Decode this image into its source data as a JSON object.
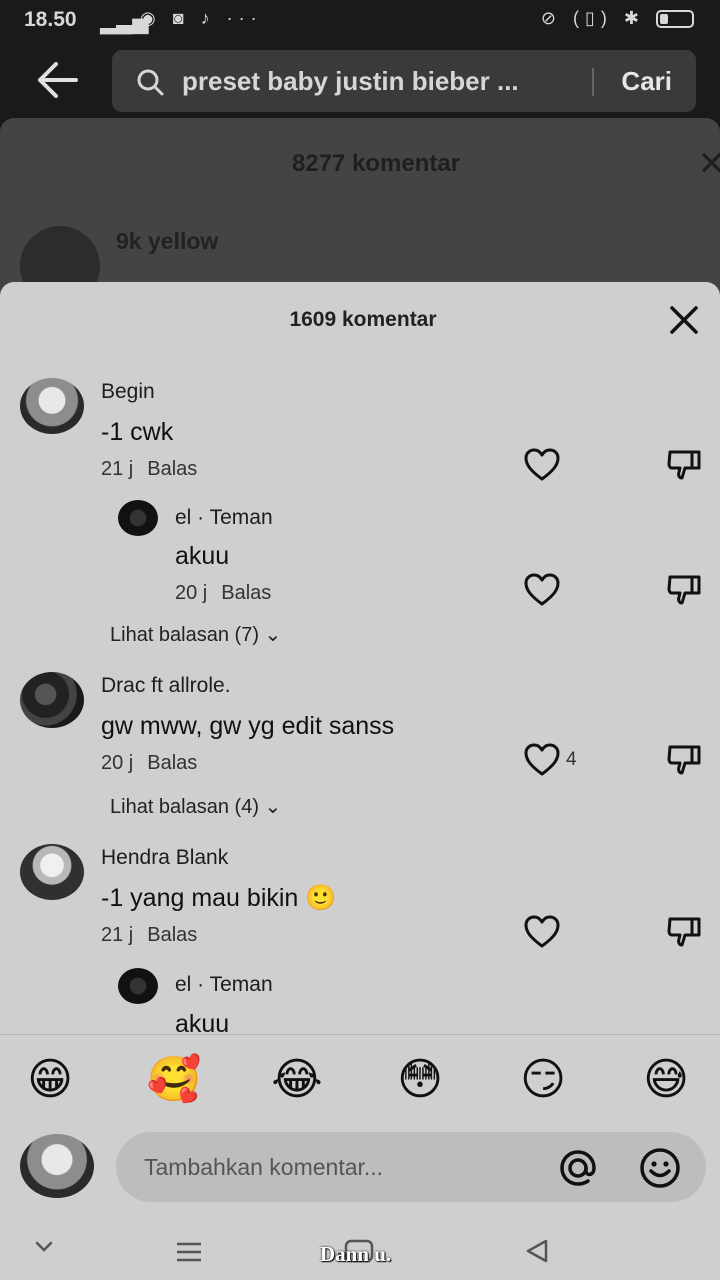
{
  "status_bar": {
    "time": "18.50",
    "signal": "▂▃▅",
    "apps": "◉ ◙ ♪ ···",
    "right": "⊘ (▯) ✱"
  },
  "search": {
    "query": "preset baby justin bieber ...",
    "action": "Cari"
  },
  "background_panel": {
    "title": "8277 komentar",
    "first_user": "9k yellow"
  },
  "sheet": {
    "title": "1609 komentar"
  },
  "comments": [
    {
      "user": "Begin",
      "text": "-1 cwk",
      "time": "21 j",
      "reply_label": "Balas",
      "likes": ""
    },
    {
      "user": "el · Teman",
      "text": "akuu",
      "time": "20 j",
      "reply_label": "Balas",
      "likes": ""
    },
    {
      "user": "Drac ft allrole.",
      "text": "gw mww, gw yg edit sanss",
      "time": "20 j",
      "reply_label": "Balas",
      "likes": "4"
    },
    {
      "user": "Hendra Blank",
      "text": "-1 yang mau bikin 🙂",
      "time": "21 j",
      "reply_label": "Balas",
      "likes": ""
    },
    {
      "user": "el · Teman",
      "text": "akuu",
      "time": "",
      "reply_label": "",
      "likes": ""
    }
  ],
  "view_replies": [
    "Lihat balasan (7)",
    "Lihat balasan (4)"
  ],
  "emojis": [
    "😁",
    "🥰",
    "😂",
    "😳",
    "😏",
    "😅"
  ],
  "input": {
    "placeholder": "Tambahkan komentar..."
  },
  "overlay_text": "Dann u."
}
